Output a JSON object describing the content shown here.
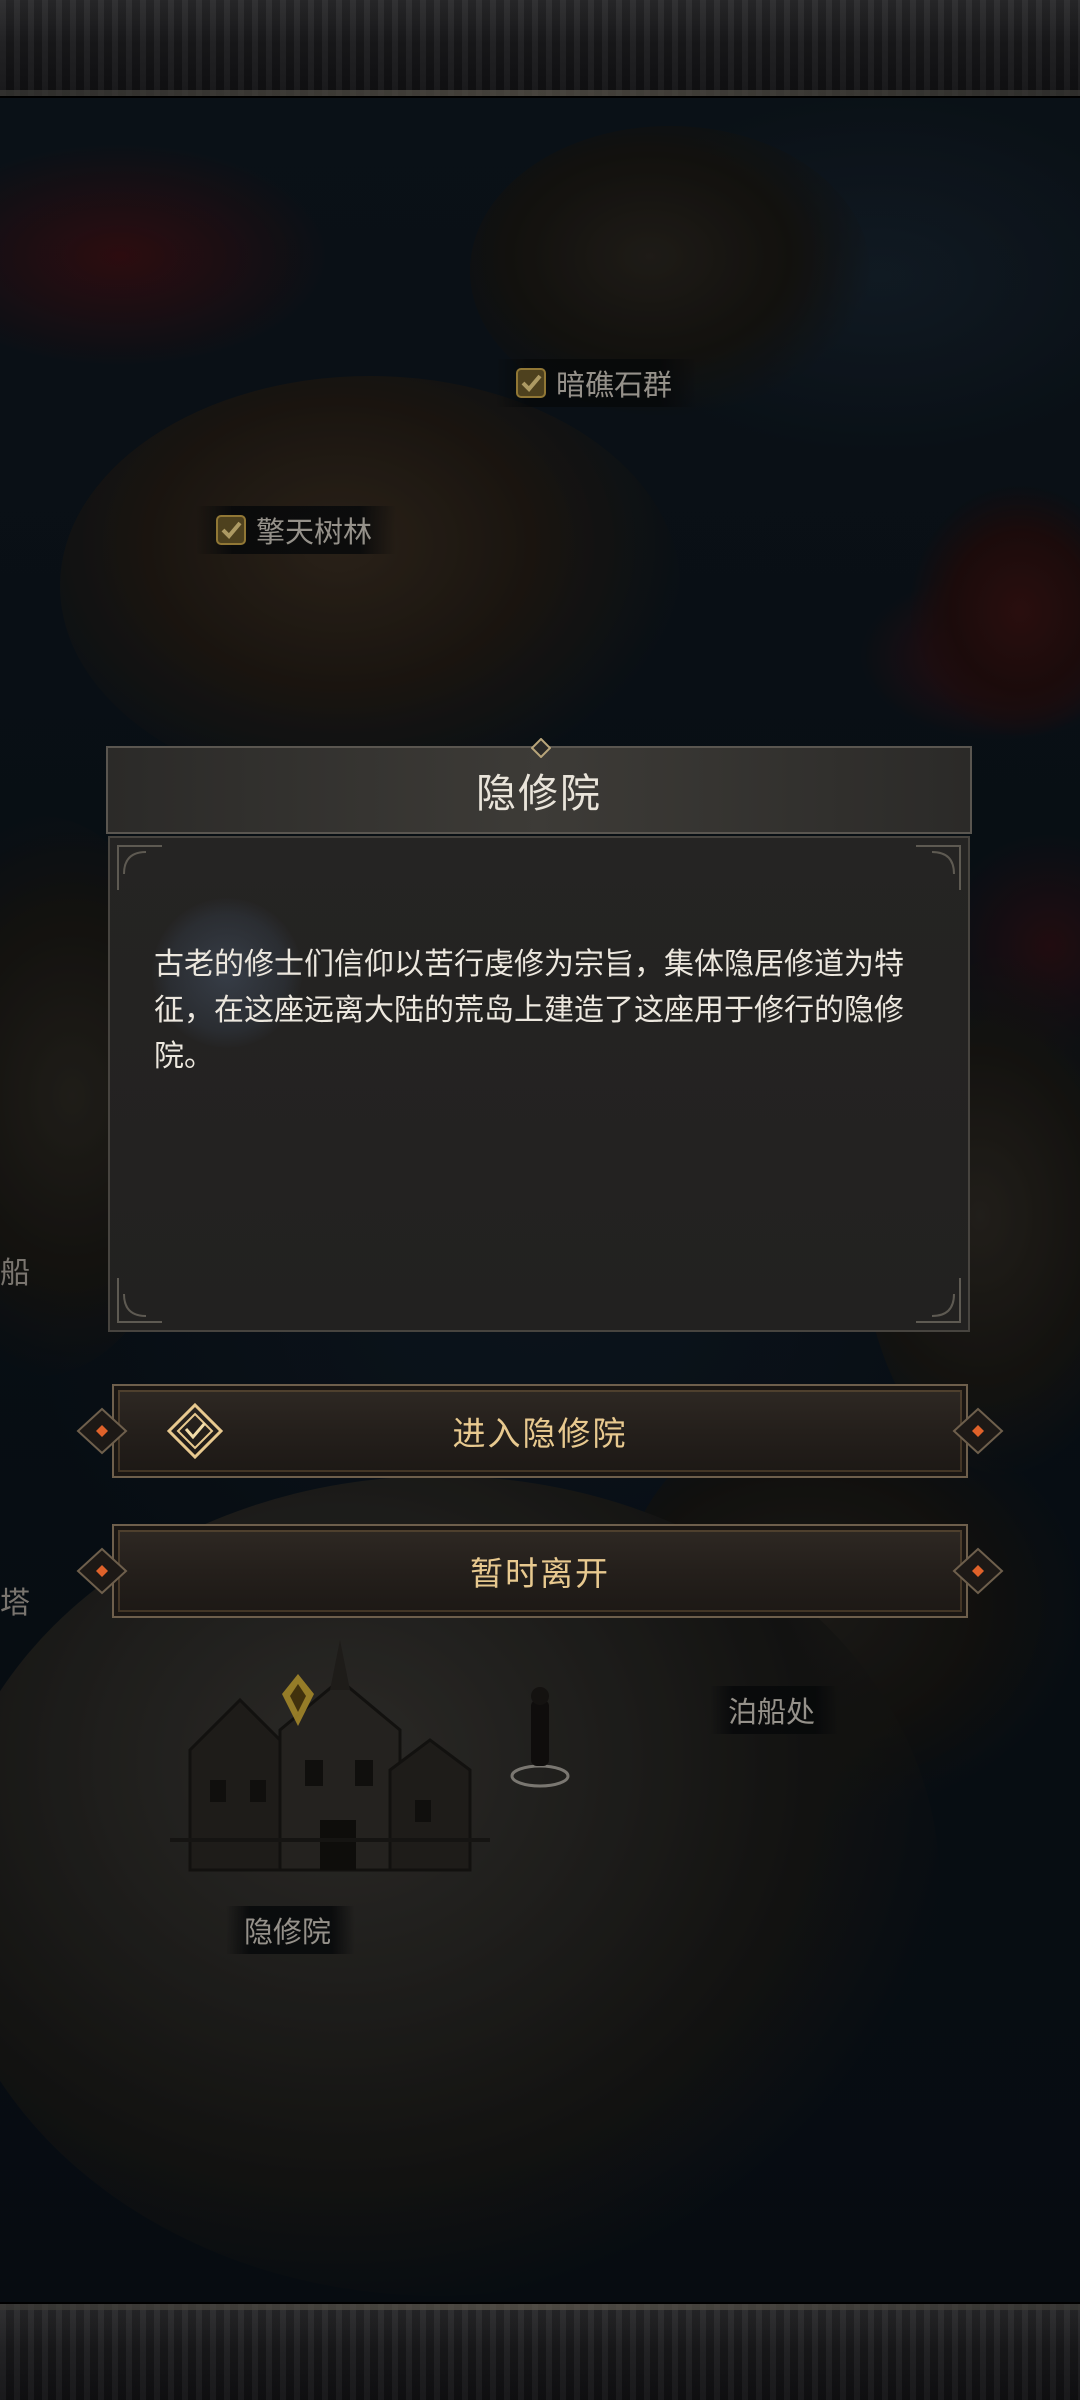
{
  "dialog": {
    "title": "隐修院",
    "description": "古老的修士们信仰以苦行虔修为宗旨，集体隐居修道为特征，在这座远离大陆的荒岛上建造了这座用于修行的隐修院。"
  },
  "buttons": {
    "enter_label": "进入隐修院",
    "leave_label": "暂时离开"
  },
  "map_labels": {
    "reef": "暗礁石群",
    "forest": "擎天树林",
    "dock": "泊船处",
    "monastery": "隐修院",
    "edge_left_ship": "船",
    "edge_left_tower": "塔"
  },
  "colors": {
    "accent_gold": "#e8c98f",
    "check_gold": "#c9a64a",
    "marker_gold": "#e0b93a",
    "ember_orange": "#e0622a"
  },
  "icons": {
    "enter": "diamond-emblem-icon",
    "visited": "check-icon",
    "marker": "location-pin-icon"
  }
}
